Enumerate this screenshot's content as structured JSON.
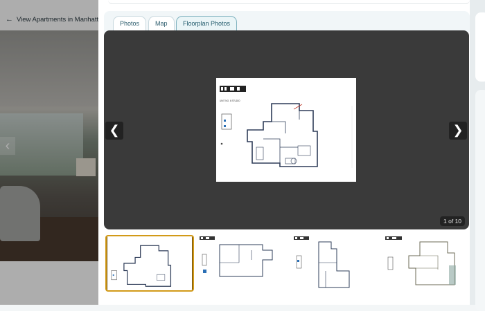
{
  "background": {
    "back_link": "View Apartments in Manhattan"
  },
  "modal": {
    "tabs": [
      {
        "label": "Photos",
        "active": false
      },
      {
        "label": "Map",
        "active": false
      },
      {
        "label": "Floorplan Photos",
        "active": true
      }
    ],
    "viewer": {
      "counter": "1 of 10",
      "prev_icon": "chevron-left-icon",
      "next_icon": "chevron-right-icon",
      "plan_header": "UNIT NO. 6 STUDIO"
    },
    "thumbnails": [
      {
        "selected": true
      },
      {
        "selected": false
      },
      {
        "selected": false
      },
      {
        "selected": false
      }
    ]
  },
  "colors": {
    "accent_border": "#d29a18",
    "tab_text": "#2e5e6e",
    "viewer_bg": "#3a3a3a"
  }
}
